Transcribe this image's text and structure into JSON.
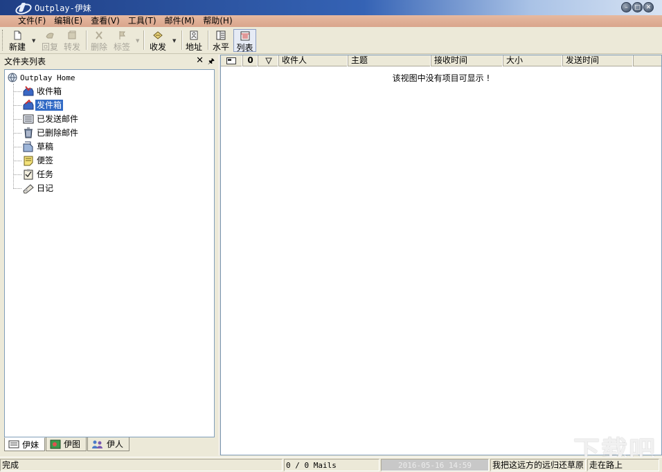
{
  "window": {
    "title": "Outplay-伊妹",
    "controls": [
      "minimize",
      "maximize",
      "close"
    ]
  },
  "menu": [
    {
      "id": "file",
      "label": "文件(F)"
    },
    {
      "id": "edit",
      "label": "编辑(E)"
    },
    {
      "id": "view",
      "label": "查看(V)"
    },
    {
      "id": "tools",
      "label": "工具(T)"
    },
    {
      "id": "mail",
      "label": "邮件(M)"
    },
    {
      "id": "help",
      "label": "帮助(H)"
    }
  ],
  "toolbar": {
    "new": "新建",
    "reply": "回复",
    "forward": "转发",
    "delete": "删除",
    "tag": "标签",
    "send_receive": "收发",
    "address": "地址",
    "horizontal": "水平",
    "list": "列表"
  },
  "folder_pane": {
    "title": "文件夹列表",
    "root": "Outplay Home",
    "items": [
      {
        "label": "收件箱",
        "icon": "inbox-icon"
      },
      {
        "label": "发件箱",
        "icon": "outbox-icon",
        "selected": true
      },
      {
        "label": "已发送邮件",
        "icon": "sent-icon"
      },
      {
        "label": "已删除邮件",
        "icon": "trash-icon"
      },
      {
        "label": "草稿",
        "icon": "draft-icon"
      },
      {
        "label": "便签",
        "icon": "note-icon"
      },
      {
        "label": "任务",
        "icon": "task-icon"
      },
      {
        "label": "日记",
        "icon": "diary-icon"
      }
    ],
    "tabs": [
      {
        "label": "伊妹",
        "active": true
      },
      {
        "label": "伊图",
        "active": false
      },
      {
        "label": "伊人",
        "active": false
      }
    ]
  },
  "mail_list": {
    "columns": [
      "收件人",
      "主题",
      "接收时间",
      "大小",
      "发送时间"
    ],
    "empty_message": "该视图中没有项目可显示 !"
  },
  "statusbar": {
    "status": "完成",
    "mail_count": "0 / 0 Mails",
    "datetime": "2016-05-16 14:59",
    "ticker": "我把这远方的远归还草原",
    "ticker2": "走在路上"
  },
  "watermark": "下载吧"
}
